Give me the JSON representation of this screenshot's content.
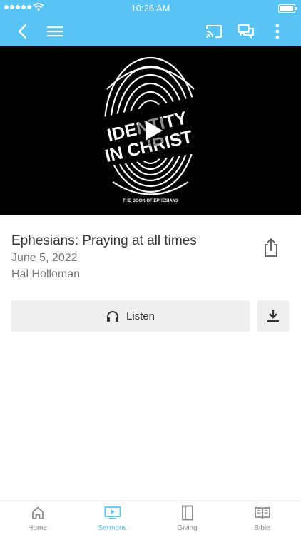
{
  "status_bar": {
    "time": "10:26 AM"
  },
  "app_bar": {
    "icons": [
      "back-icon",
      "menu-icon",
      "cast-icon",
      "chat-icon",
      "more-vertical-icon"
    ]
  },
  "video": {
    "artwork_text": {
      "line1": "IDENTITY",
      "line2": "IN CHRIST",
      "series": "THE BOOK OF EPHESIANS"
    }
  },
  "sermon": {
    "title": "Ephesians: Praying at all times",
    "date": "June 5, 2022",
    "speaker": "Hal Holloman"
  },
  "actions": {
    "listen_label": "Listen"
  },
  "tabs": [
    {
      "label": "Home",
      "icon": "home-icon",
      "active": false
    },
    {
      "label": "Sermons",
      "icon": "video-icon",
      "active": true
    },
    {
      "label": "Giving",
      "icon": "book-icon",
      "active": false
    },
    {
      "label": "Bible",
      "icon": "open-book-icon",
      "active": false
    }
  ],
  "colors": {
    "accent": "#57c4f5",
    "inactive": "#8a8a8a",
    "button_bg": "#efefef"
  }
}
